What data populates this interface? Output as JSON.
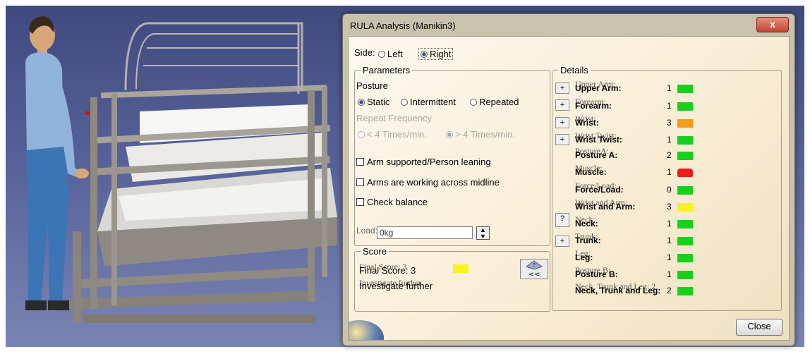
{
  "dialog": {
    "title": "RULA Analysis (Manikin3)",
    "close_glyph": "x",
    "close_button_label": "Close"
  },
  "side": {
    "label": "Side:",
    "options": [
      "Left",
      "Right"
    ],
    "selected": "Right"
  },
  "parameters": {
    "group_title": "Parameters",
    "posture_label": "Posture",
    "posture_options": [
      "Static",
      "Intermittent",
      "Repeated"
    ],
    "posture_selected": "Static",
    "repeat_frequency_label": "Repeat Frequency",
    "repeat_options": [
      "< 4 Times/min.",
      "> 4 Times/min."
    ],
    "repeat_selected": "> 4 Times/min.",
    "arm_supported_label": "Arm supported/Person leaning",
    "arms_midline_label": "Arms are working across midline",
    "check_balance_label": "Check balance",
    "load_label": "Load:",
    "load_value": "0kg"
  },
  "score": {
    "group_title": "Score",
    "final_score_label": "Final Score: 3",
    "final_score_ghost": "Final Score: 3",
    "final_score_color": "#f8f21d",
    "recommendation": "Investigate further",
    "recommendation_ghost": "Investigate further",
    "collapse_label": "<<"
  },
  "details": {
    "group_title": "Details",
    "rows": [
      {
        "ghost": "Upper Arm:",
        "label": "Upper Arm:",
        "score": "1",
        "color": "green"
      },
      {
        "ghost": "Forearm:",
        "label": "Forearm:",
        "score": "1",
        "color": "green"
      },
      {
        "ghost": "Wrist:",
        "label": "Wrist:",
        "score": "3",
        "color": "orange"
      },
      {
        "ghost": "Wrist Twist:",
        "label": "Wrist Twist:",
        "score": "1",
        "color": "green"
      },
      {
        "ghost": "PostureA:",
        "label": "Posture A:",
        "score": "2",
        "color": "green"
      },
      {
        "ghost": "Muscle:",
        "label": "Muscle:",
        "score": "1",
        "color": "red"
      },
      {
        "ghost": "Force/Load:",
        "label": "Force/Load:",
        "score": "0",
        "color": "green"
      },
      {
        "ghost": "Wrist and Arm:",
        "label": "Wrist and Arm:",
        "score": "3",
        "color": "yellow"
      },
      {
        "ghost": "Neck:",
        "label": "Neck:",
        "score": "1",
        "color": "green"
      },
      {
        "ghost": "Trunk:",
        "label": "Trunk:",
        "score": "1",
        "color": "green"
      },
      {
        "ghost": "Leg:",
        "label": "Leg:",
        "score": "1",
        "color": "green"
      },
      {
        "ghost": "Posture B:",
        "label": "Posture B:",
        "score": "1",
        "color": "green"
      },
      {
        "ghost": "Neck, Trunk and Leg: 2",
        "label": "Neck, Trunk and Leg:",
        "score": "2",
        "color": "green"
      }
    ]
  },
  "colors": {
    "green": "#17d01c",
    "orange": "#f39b1e",
    "yellow": "#f8f21d",
    "red": "#ea1b1b",
    "selection": "#2d4e96"
  }
}
